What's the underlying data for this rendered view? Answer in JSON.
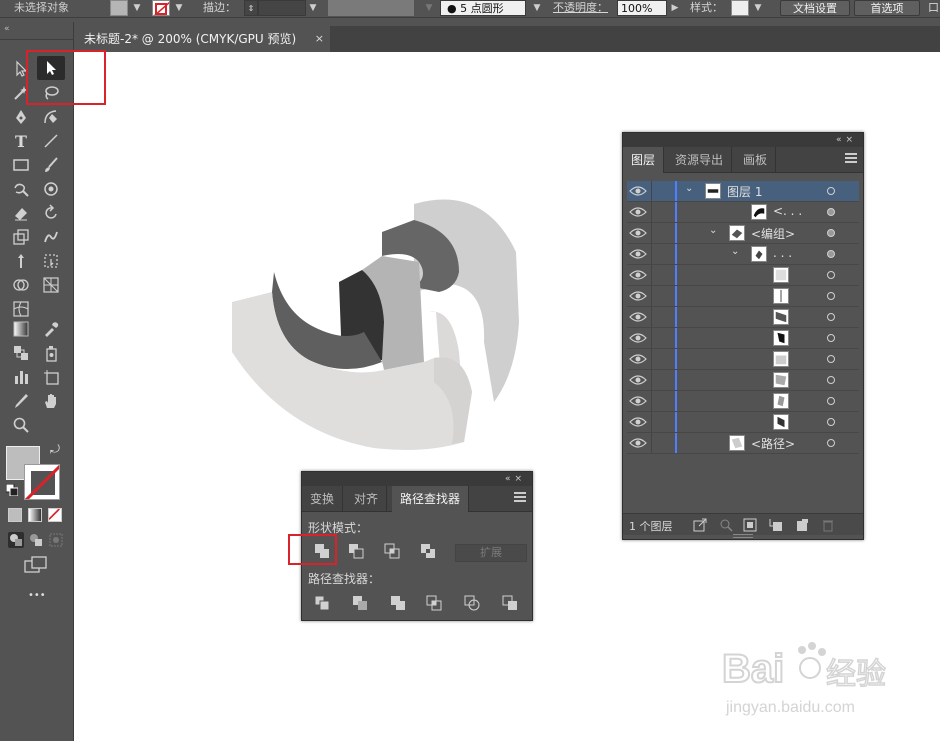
{
  "control_bar": {
    "selection_status": "未选择对象",
    "stroke_label": "描边：",
    "brush_label": "5 点圆形",
    "opacity_label": "不透明度：",
    "opacity_value": "100%",
    "style_label": "样式：",
    "doc_setup_button": "文档设置",
    "preferences_button": "首选项",
    "overflow_char": "口"
  },
  "document": {
    "tab_title": "未标题-2* @ 200% (CMYK/GPU 预览)",
    "tab_close": "×"
  },
  "toolbar": {
    "type_tool_glyph": "T",
    "more_tools_glyph": "•••"
  },
  "pathfinder_panel": {
    "tabs": [
      "变换",
      "对齐",
      "路径查找器"
    ],
    "active_tab_index": 2,
    "shape_modes_label": "形状模式：",
    "expand_button": "扩展",
    "pathfinders_label": "路径查找器：",
    "shape_mode_icons": [
      "unite-icon",
      "minus-front-icon",
      "intersect-icon",
      "exclude-icon"
    ],
    "pathfinder_icons": [
      "divide-icon",
      "trim-icon",
      "merge-icon",
      "crop-icon",
      "outline-icon",
      "minus-back-icon"
    ]
  },
  "layers_panel": {
    "tabs": [
      "图层",
      "资源导出",
      "画板"
    ],
    "active_tab_index": 0,
    "rows": [
      {
        "name": "图层  1",
        "indent": 0,
        "twisty": "⌄",
        "selected": true,
        "target": "open"
      },
      {
        "name": "<. . .",
        "indent": 2,
        "twisty": "",
        "selected": false,
        "target": "filled"
      },
      {
        "name": "<编组>",
        "indent": 1,
        "twisty": "⌄",
        "selected": false,
        "target": "filled"
      },
      {
        "name": ". . .",
        "indent": 2,
        "twisty": "⌄",
        "selected": false,
        "target": "filled"
      },
      {
        "name": "",
        "indent": 3,
        "twisty": "",
        "selected": false,
        "target": "open"
      },
      {
        "name": "",
        "indent": 3,
        "twisty": "",
        "selected": false,
        "target": "open"
      },
      {
        "name": "",
        "indent": 3,
        "twisty": "",
        "selected": false,
        "target": "open"
      },
      {
        "name": "",
        "indent": 3,
        "twisty": "",
        "selected": false,
        "target": "open"
      },
      {
        "name": "",
        "indent": 3,
        "twisty": "",
        "selected": false,
        "target": "open"
      },
      {
        "name": "",
        "indent": 3,
        "twisty": "",
        "selected": false,
        "target": "open"
      },
      {
        "name": "",
        "indent": 3,
        "twisty": "",
        "selected": false,
        "target": "open"
      },
      {
        "name": "",
        "indent": 3,
        "twisty": "",
        "selected": false,
        "target": "open"
      },
      {
        "name": "<路径>",
        "indent": 1,
        "twisty": "",
        "selected": false,
        "target": "open"
      }
    ],
    "footer_count": "1 个图层"
  },
  "watermark": {
    "brand_text": "Bai",
    "brand_text_tail": "经验",
    "url": "jingyan.baidu.com"
  },
  "colors": {
    "accent_highlight": "#d9232a",
    "layer_color_bar": "#4f7fff",
    "selected_row": "#46607d"
  }
}
